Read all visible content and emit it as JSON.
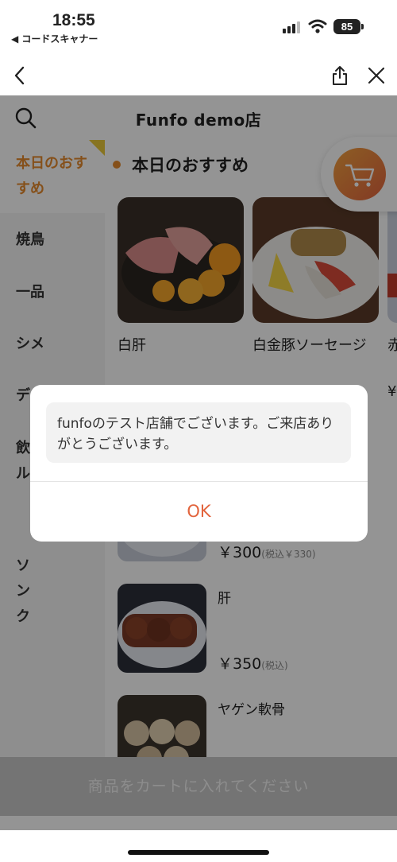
{
  "status_bar": {
    "time": "18:55",
    "back_app": "◀ コードスキャナー",
    "battery": "85"
  },
  "navbar": {
    "back_icon": "chevron-left-icon",
    "share_icon": "share-icon",
    "close_icon": "close-icon"
  },
  "header": {
    "title": "Funfo demo店",
    "search_icon": "search-icon"
  },
  "sidebar": {
    "items": [
      {
        "label": "本日のおすすめ"
      },
      {
        "label": "焼鳥"
      },
      {
        "label": "一品"
      },
      {
        "label": "シメ"
      },
      {
        "label": "デ"
      },
      {
        "label": "飲ル"
      },
      {
        "label": "ソンク"
      }
    ]
  },
  "section": {
    "title": "本日のおすすめ"
  },
  "cards": [
    {
      "name": "白肝"
    },
    {
      "name": "白金豚ソーセージ"
    },
    {
      "name": "赤"
    }
  ],
  "partial_price": "¥",
  "list_items": [
    {
      "name": "",
      "price": "￥300",
      "tax": "(税込￥330)"
    },
    {
      "name": "肝",
      "price": "￥350",
      "tax": "(税込)"
    },
    {
      "name": "ヤゲン軟骨"
    }
  ],
  "cart": {
    "icon": "cart-icon"
  },
  "bottom_bar": {
    "label": "商品をカートに入れてください"
  },
  "dialog": {
    "message": "funfoのテスト店舗でございます。ご来店ありがとうございます。",
    "ok_label": "OK"
  },
  "colors": {
    "accent": "#e58a2e",
    "ok_text": "#e2643d"
  }
}
